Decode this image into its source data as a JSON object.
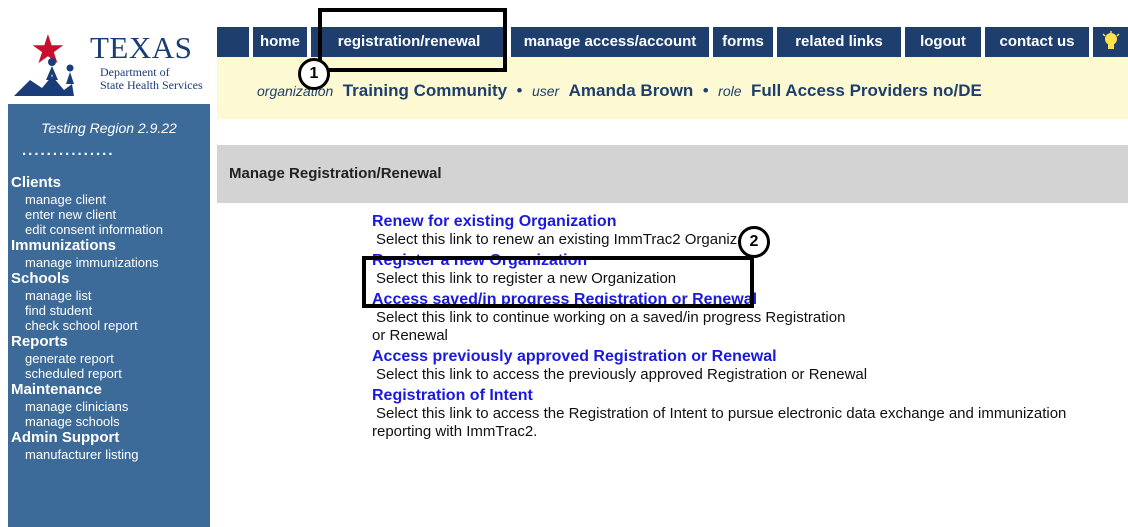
{
  "logo": {
    "title": "TEXAS",
    "dept_line1": "Department of",
    "dept_line2": "State Health Services"
  },
  "sidebar": {
    "region": "Testing Region 2.9.22",
    "dots": "...............",
    "sections": [
      {
        "heading": "Clients",
        "items": [
          "manage client",
          "enter new client",
          "edit consent information"
        ]
      },
      {
        "heading": "Immunizations",
        "items": [
          "manage immunizations"
        ]
      },
      {
        "heading": "Schools",
        "items": [
          "manage list",
          "find student",
          "check school report"
        ]
      },
      {
        "heading": "Reports",
        "items": [
          "generate report",
          "scheduled report"
        ]
      },
      {
        "heading": "Maintenance",
        "items": [
          "manage clinicians",
          "manage schools"
        ]
      },
      {
        "heading": "Admin Support",
        "items": [
          "manufacturer listing"
        ]
      }
    ]
  },
  "tabs": [
    "home",
    "registration/renewal",
    "manage access/account",
    "forms",
    "related links",
    "logout",
    "contact us"
  ],
  "orgbar": {
    "org_label": "organization",
    "org_value": "Training Community",
    "user_label": "user",
    "user_value": "Amanda Brown",
    "role_label": "role",
    "role_value": "Full Access Providers no/DE",
    "sep": "•"
  },
  "page_title": "Manage Registration/Renewal",
  "links": [
    {
      "label": "Renew for existing Organization",
      "desc": "Select this link to renew an existing ImmTrac2 Organization"
    },
    {
      "label": "Register a new Organization",
      "desc": "Select this link to register a new Organization"
    },
    {
      "label": "Access saved/in progress Registration or Renewal",
      "desc": "Select this link to continue working on a saved/in progress Registration or Renewal"
    },
    {
      "label": "Access previously approved Registration or Renewal",
      "desc": "Select this link to access the previously approved Registration or Renewal"
    },
    {
      "label": "Registration of Intent",
      "desc": "Select this link to access the Registration of Intent to pursue electronic data exchange and immunization reporting with ImmTrac2."
    }
  ],
  "annotations": {
    "badge1": "1",
    "badge2": "2"
  },
  "colors": {
    "nav": "#1e3f6e",
    "sidebar": "#3d6b99",
    "orgbar": "#fdf9d2",
    "link": "#1a1adf"
  }
}
